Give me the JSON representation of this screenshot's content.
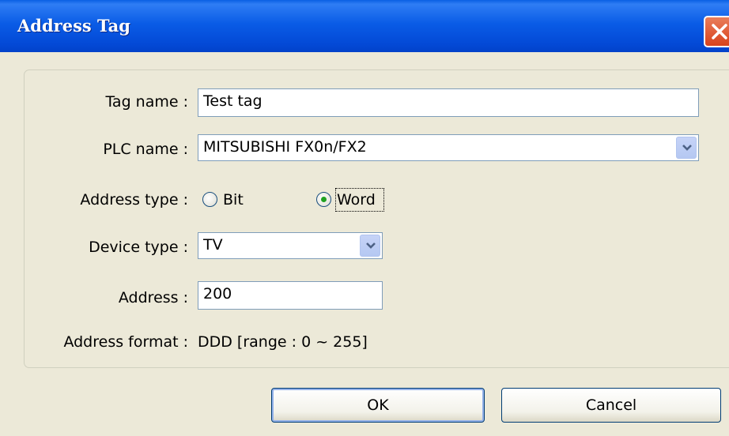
{
  "window": {
    "title": "Address Tag"
  },
  "form": {
    "tag_name": {
      "label": "Tag name :",
      "value": "Test tag"
    },
    "plc_name": {
      "label": "PLC name :",
      "value": "MITSUBISHI FX0n/FX2"
    },
    "address_type": {
      "label": "Address type :",
      "options": [
        "Bit",
        "Word"
      ],
      "selected": "Word"
    },
    "device_type": {
      "label": "Device type :",
      "value": "TV"
    },
    "address": {
      "label": "Address :",
      "value": "200"
    },
    "address_format": {
      "label": "Address format :",
      "value": "DDD [range : 0 ~ 255]"
    }
  },
  "buttons": {
    "ok": "OK",
    "cancel": "Cancel"
  },
  "colors": {
    "titlebar": "#0a5ce6",
    "close": "#d8421c",
    "background": "#ece9d8"
  },
  "icons": {
    "close": "close-icon",
    "dropdown": "chevron-down-icon"
  }
}
